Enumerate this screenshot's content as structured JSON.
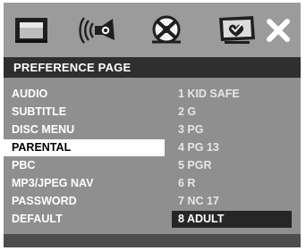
{
  "title": "PREFERENCE PAGE",
  "icons": [
    {
      "name": "general-setup-icon"
    },
    {
      "name": "audio-setup-icon"
    },
    {
      "name": "video-setup-icon"
    },
    {
      "name": "preference-page-icon"
    },
    {
      "name": "exit-icon"
    }
  ],
  "menu": [
    {
      "label": "AUDIO"
    },
    {
      "label": "SUBTITLE"
    },
    {
      "label": "DISC MENU"
    },
    {
      "label": "PARENTAL"
    },
    {
      "label": "PBC"
    },
    {
      "label": "MP3/JPEG NAV"
    },
    {
      "label": "PASSWORD"
    },
    {
      "label": "DEFAULT"
    }
  ],
  "options": [
    {
      "label": "1 KID SAFE"
    },
    {
      "label": "2 G"
    },
    {
      "label": "3 PG"
    },
    {
      "label": "4 PG 13"
    },
    {
      "label": "5 PGR"
    },
    {
      "label": "6 R"
    },
    {
      "label": "7 NC 17"
    },
    {
      "label": "8 ADULT"
    }
  ],
  "selected_menu": "PARENTAL",
  "selected_option": "8 ADULT",
  "colors": {
    "panel": "#8f8f8f",
    "titlebar": "#2f2f2f",
    "highlight_light": "#ffffff",
    "highlight_dark": "#262626"
  }
}
